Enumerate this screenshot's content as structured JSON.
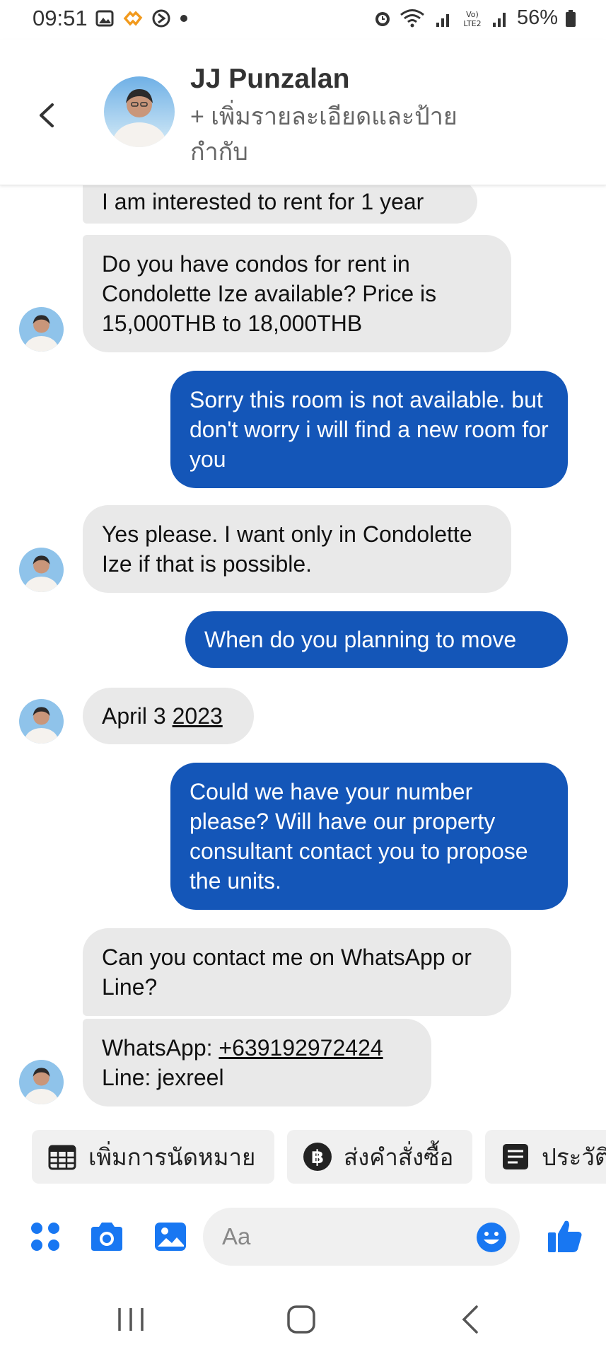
{
  "status_bar": {
    "time": "09:51",
    "battery": "56%"
  },
  "header": {
    "contact_name": "JJ Punzalan",
    "subtitle": "+ เพิ่มรายละเอียดและป้ายกำกับ"
  },
  "messages": [
    {
      "direction": "incoming",
      "text": "I am interested to rent for 1 year"
    },
    {
      "direction": "incoming",
      "text": "Do you have condos for rent in Condolette Ize available? Price is 15,000THB to 18,000THB"
    },
    {
      "direction": "outgoing",
      "text": "Sorry this room is not available. but don't worry i will find a new room for you"
    },
    {
      "direction": "incoming",
      "text": "Yes please. I want only in Condolette Ize if that is possible."
    },
    {
      "direction": "outgoing",
      "text": "When do you planning to move"
    },
    {
      "direction": "incoming",
      "text_prefix": "April 3 ",
      "text_link": "2023"
    },
    {
      "direction": "outgoing",
      "text": "Could we have your number please? Will have our property consultant contact you to propose the units."
    },
    {
      "direction": "incoming",
      "text": "Can you contact me on WhatsApp or Line?"
    },
    {
      "direction": "incoming",
      "text_prefix": "WhatsApp: ",
      "text_link": "+639192972424",
      "text_line2": "Line: jexreel"
    }
  ],
  "quick_actions": [
    {
      "label": "เพิ่มการนัดหมาย",
      "icon": "calendar-icon"
    },
    {
      "label": "ส่งคำสั่งซื้อ",
      "icon": "baht-icon"
    },
    {
      "label": "ประวัติ",
      "icon": "list-icon"
    }
  ],
  "composer": {
    "placeholder": "Aa"
  },
  "colors": {
    "outgoing_bubble": "#1456b8",
    "incoming_bubble": "#e9e9e9",
    "accent": "#1877f2"
  }
}
